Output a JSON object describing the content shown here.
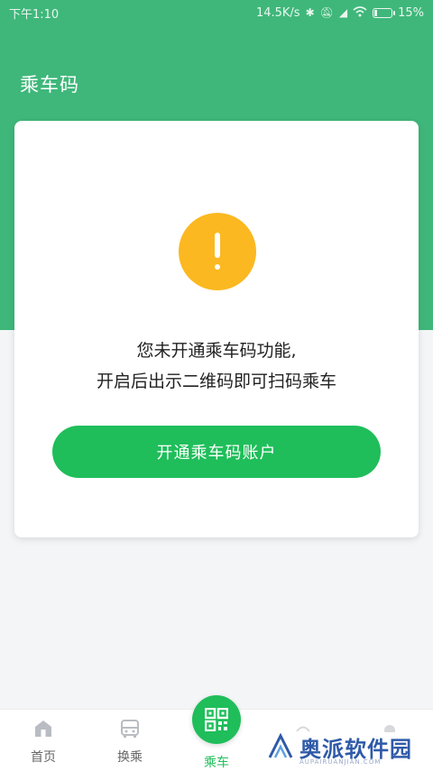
{
  "status_bar": {
    "time": "下午1:10",
    "speed": "14.5K/s",
    "battery": "15%"
  },
  "header": {
    "title": "乘车码"
  },
  "card": {
    "line1": "您未开通乘车码功能,",
    "line2": "开启后出示二维码即可扫码乘车",
    "button_label": "开通乘车码账户",
    "warning_icon": "exclamation-circle-icon"
  },
  "tabs": [
    {
      "label": "首页",
      "icon": "home-icon"
    },
    {
      "label": "换乘",
      "icon": "bus-icon"
    },
    {
      "label": "乘车",
      "icon": "qr-code-icon",
      "active": true
    }
  ],
  "watermark": {
    "text": "奥派软件园",
    "sub": "AUPAIRUANJIAN.COM"
  },
  "colors": {
    "header_green": "#3fb77a",
    "button_green": "#1fbe5a",
    "warning_yellow": "#fbb820"
  }
}
